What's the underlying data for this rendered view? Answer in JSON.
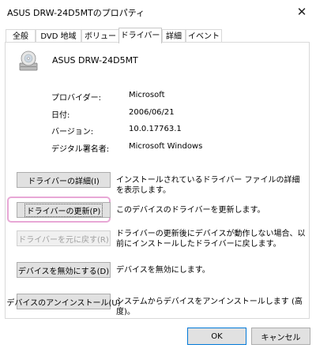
{
  "window": {
    "title": "ASUS DRW-24D5MTのプロパティ"
  },
  "tabs": [
    {
      "label": "全般"
    },
    {
      "label": "DVD 地域"
    },
    {
      "label": "ボリューム"
    },
    {
      "label": "ドライバー"
    },
    {
      "label": "詳細"
    },
    {
      "label": "イベント"
    }
  ],
  "device": {
    "name": "ASUS DRW-24D5MT",
    "icon": "optical-drive-icon"
  },
  "info": [
    {
      "label": "プロバイダー:",
      "value": "Microsoft"
    },
    {
      "label": "日付:",
      "value": "2006/06/21"
    },
    {
      "label": "バージョン:",
      "value": "10.0.17763.1"
    },
    {
      "label": "デジタル署名者:",
      "value": "Microsoft Windows"
    }
  ],
  "actions": [
    {
      "button": "ドライバーの詳細(I)",
      "description": "インストールされているドライバー ファイルの詳細を表示します。"
    },
    {
      "button": "ドライバーの更新(P)",
      "description": "このデバイスのドライバーを更新します。"
    },
    {
      "button": "ドライバーを元に戻す(R)",
      "description": "ドライバーの更新後にデバイスが動作しない場合、以前にインストールしたドライバーに戻します。"
    },
    {
      "button": "デバイスを無効にする(D)",
      "description": "デバイスを無効にします。"
    },
    {
      "button": "デバイスのアンインストール(U)",
      "description": "システムからデバイスをアンインストールします (高度)。"
    }
  ],
  "footer": {
    "ok": "OK",
    "cancel": "キャンセル"
  },
  "colors": {
    "highlight": "#e8a8d6",
    "accent": "#0078d7"
  }
}
